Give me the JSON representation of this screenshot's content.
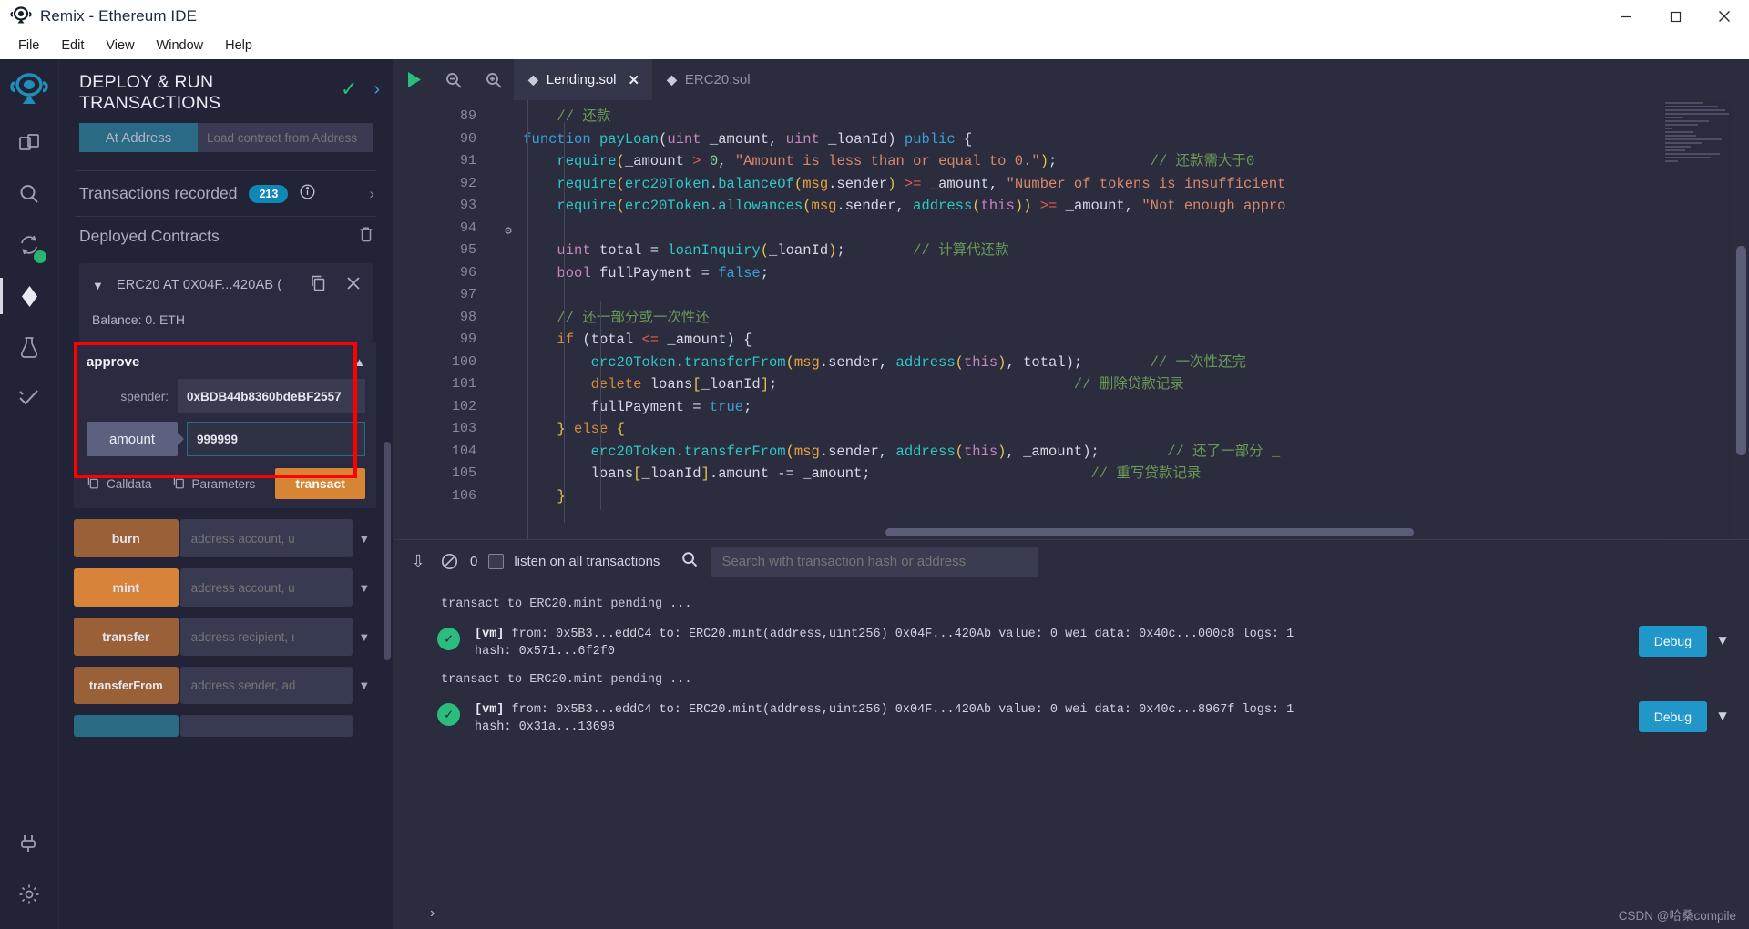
{
  "window": {
    "title": "Remix - Ethereum IDE",
    "logo_icon": "remix-logo-icon",
    "minimize_label": "—",
    "maximize_label": "❐",
    "close_label": "✕"
  },
  "menubar": {
    "items": [
      {
        "label": "File",
        "name": "menu-file"
      },
      {
        "label": "Edit",
        "name": "menu-edit"
      },
      {
        "label": "View",
        "name": "menu-view"
      },
      {
        "label": "Window",
        "name": "menu-window"
      },
      {
        "label": "Help",
        "name": "menu-help"
      }
    ]
  },
  "rail": {
    "items": [
      {
        "name": "sidebar-icon-file-explorer",
        "glyph": "⧉"
      },
      {
        "name": "sidebar-icon-search",
        "glyph": "⌕"
      },
      {
        "name": "sidebar-icon-solidity-compiler",
        "glyph": "↻"
      },
      {
        "name": "sidebar-icon-deploy-run",
        "glyph": "◈"
      },
      {
        "name": "sidebar-icon-debugger",
        "glyph": "⚗"
      },
      {
        "name": "sidebar-icon-unit-testing",
        "glyph": "✓"
      },
      {
        "name": "sidebar-icon-plugin-manager",
        "glyph": "⚡"
      },
      {
        "name": "sidebar-icon-settings",
        "glyph": "⚙"
      }
    ]
  },
  "panel": {
    "title": "DEPLOY & RUN TRANSACTIONS",
    "header_check_icon": "check-icon",
    "header_expand_icon": "chevron-right-icon",
    "at_address_button": "At Address",
    "at_address_placeholder": "Load contract from Address",
    "transactions_recorded_label": "Transactions recorded",
    "transactions_recorded_count": "213",
    "deployed_contracts_label": "Deployed Contracts",
    "trash_icon": "trash-icon",
    "contract": {
      "name": "ERC20 AT 0X04F...420AB (",
      "copy_icon": "copy-icon",
      "close_icon": "close-icon",
      "chevron_icon": "chevron-down-icon",
      "balance": "Balance: 0. ETH"
    },
    "approve": {
      "title": "approve",
      "collapse_icon": "chevron-up-icon",
      "spender_label": "spender:",
      "spender_value": "0xBDB44b8360bdeBF2557",
      "amount_tooltip": "amount",
      "amount_value": "999999",
      "calldata_label": "Calldata",
      "parameters_label": "Parameters",
      "calldata_icon": "copy-icon",
      "parameters_icon": "copy-icon",
      "transact_label": "transact"
    },
    "functions": [
      {
        "name": "burn",
        "placeholder": "address account, u",
        "color": "#9a6139"
      },
      {
        "name": "mint",
        "placeholder": "address account, u",
        "color": "#d7833a"
      },
      {
        "name": "transfer",
        "placeholder": "address recipient, ı",
        "color": "#9a6139"
      },
      {
        "name": "transferFrom",
        "placeholder": "address sender, ad",
        "color": "#9a6139"
      },
      {
        "name": "",
        "placeholder": "",
        "color": "#2b6a85"
      }
    ],
    "function_chevron_icon": "chevron-down-icon"
  },
  "editor": {
    "toolbar": {
      "run_icon": "run-play-icon",
      "zoom_out_icon": "zoom-out-icon",
      "zoom_in_icon": "zoom-in-icon"
    },
    "tabs": [
      {
        "label": "Lending.sol",
        "active": true,
        "file_icon": "solidity-icon",
        "close_icon": "close-icon"
      },
      {
        "label": "ERC20.sol",
        "active": false,
        "file_icon": "solidity-icon",
        "close_icon": null
      }
    ],
    "first_line": 89,
    "lines": [
      {
        "n": 89,
        "html": "        <span class='cm'>// 还款</span>"
      },
      {
        "n": 90,
        "html": "    <span class='k'>function</span> <span class='fn'>payLoan</span><span class='pn'>(</span><span class='kp'>uint</span> <span class='pn'>_amount, </span><span class='kp'>uint</span> <span class='pn'>_loanId)</span> <span class='k'>public</span> <span class='pn'>{</span>"
      },
      {
        "n": 91,
        "html": "        <span class='fn'>require</span><span class='br'>(</span><span class='pn'>_amount </span><span class='op'>></span> <span class='nm'>0</span><span class='pn'>, </span><span class='st'>\"Amount is less than or equal to 0.\"</span><span class='br'>)</span><span class='pn'>;</span>           <span class='cm'>// 还款需大于0</span>"
      },
      {
        "n": 92,
        "html": "        <span class='fn'>require</span><span class='br'>(</span><span class='fn'>erc20Token</span><span class='pn'>.</span><span class='fn'>balanceOf</span><span class='br'>(</span><span class='gl'>msg</span><span class='pn'>.sender</span><span class='br'>)</span> <span class='op'>>=</span> <span class='pn'>_amount, </span><span class='st'>\"Number of tokens is insufficient</span>"
      },
      {
        "n": 93,
        "html": "        <span class='fn'>require</span><span class='br'>(</span><span class='fn'>erc20Token</span><span class='pn'>.</span><span class='fn'>allowances</span><span class='br'>(</span><span class='gl'>msg</span><span class='pn'>.sender, </span><span class='fn'>address</span><span class='br'>(</span><span class='kp'>this</span><span class='br'>))</span> <span class='op'>>=</span> <span class='pn'>_amount, </span><span class='st'>\"Not enough appro</span>"
      },
      {
        "n": 94,
        "html": "",
        "icon": "gas-estimate-icon"
      },
      {
        "n": 95,
        "html": "        <span class='kp'>uint</span> <span class='pn'>total </span><span class='pn'>= </span><span class='fn'>loanInquiry</span><span class='br'>(</span><span class='pn'>_loanId</span><span class='br'>)</span><span class='pn'>;</span>        <span class='cm'>// 计算代还款</span>"
      },
      {
        "n": 96,
        "html": "        <span class='kp'>bool</span> <span class='pn'>fullPayment = </span><span class='k'>false</span><span class='pn'>;</span>"
      },
      {
        "n": 97,
        "html": ""
      },
      {
        "n": 98,
        "html": "        <span class='cm'>// 还一部分或一次性还</span>"
      },
      {
        "n": 99,
        "html": "        <span class='ky'>if</span> <span class='pn'>(total </span><span class='op'>&lt;=</span> <span class='pn'>_amount) {</span>"
      },
      {
        "n": 100,
        "html": "            <span class='fn'>erc20Token</span><span class='pn'>.</span><span class='fn'>transferFrom</span><span class='br'>(</span><span class='gl'>msg</span><span class='pn'>.sender, </span><span class='fn'>address</span><span class='br'>(</span><span class='kp'>this</span><span class='br'>)</span><span class='pn'>, total);</span>        <span class='cm'>// 一次性还完</span>"
      },
      {
        "n": 101,
        "html": "            <span class='ky'>delete</span> <span class='pn'>loans</span><span class='br'>[</span><span class='pn'>_loanId</span><span class='br'>]</span><span class='pn'>;</span>                                   <span class='cm'>// 删除贷款记录</span>"
      },
      {
        "n": 102,
        "html": "            <span class='pn'>fullPayment = </span><span class='k'>true</span><span class='pn'>;</span>"
      },
      {
        "n": 103,
        "html": "        <span class='br'>}</span> <span class='ky'>else</span> <span class='br'>{</span>"
      },
      {
        "n": 104,
        "html": "            <span class='fn'>erc20Token</span><span class='pn'>.</span><span class='fn'>transferFrom</span><span class='br'>(</span><span class='gl'>msg</span><span class='pn'>.sender, </span><span class='fn'>address</span><span class='br'>(</span><span class='kp'>this</span><span class='br'>)</span><span class='pn'>, _amount);</span>        <span class='cm'>// 还了一部分 _</span>"
      },
      {
        "n": 105,
        "html": "            <span class='pn'>loans</span><span class='br'>[</span><span class='pn'>_loanId</span><span class='br'>]</span><span class='pn'>.amount -= _amount;</span>                          <span class='cm'>// 重写贷款记录</span>"
      },
      {
        "n": 106,
        "html": "        <span class='br'>}</span>"
      }
    ]
  },
  "terminal": {
    "collapse_icon": "chevron-double-down-icon",
    "clear_icon": "no-entry-icon",
    "pending_count": "0",
    "listen_label": "listen on all transactions",
    "listen_checked": false,
    "search_icon": "search-icon",
    "search_placeholder": "Search with transaction hash or address",
    "entries": [
      {
        "pending": "transact to ERC20.mint pending ...",
        "status_icon": "check-circle-icon",
        "line1_prefix": "[vm]",
        "line1": "from: 0x5B3...eddC4 to: ERC20.mint(address,uint256) 0x04F...420Ab value: 0 wei data: 0x40c...000c8 logs: 1",
        "line2": "hash: 0x571...6f2f0",
        "debug_label": "Debug",
        "expand_icon": "chevron-down-icon"
      },
      {
        "pending": "transact to ERC20.mint pending ...",
        "status_icon": "check-circle-icon",
        "line1_prefix": "[vm]",
        "line1": "from: 0x5B3...eddC4 to: ERC20.mint(address,uint256) 0x04F...420Ab value: 0 wei data: 0x40c...8967f logs: 1",
        "line2": "hash: 0x31a...13698",
        "debug_label": "Debug",
        "expand_icon": "chevron-down-icon"
      }
    ],
    "prompt_icon": "chevron-right-icon",
    "watermark": "CSDN @哈桑compile"
  },
  "colors": {
    "accent_orange": "#d78535",
    "accent_blue": "#2196c9",
    "success_green": "#2bbd7e",
    "highlight_red": "#ff0000",
    "badge_blue": "#0f88b8"
  }
}
